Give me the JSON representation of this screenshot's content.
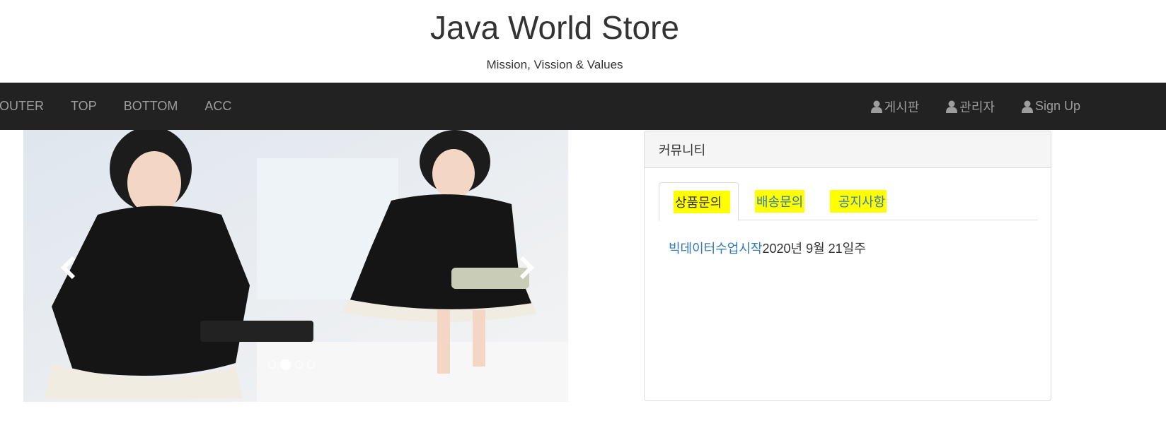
{
  "header": {
    "title": "Java World Store",
    "subtitle": "Mission, Vission & Values"
  },
  "navbar": {
    "left_items": [
      "OUTER",
      "TOP",
      "BOTTOM",
      "ACC"
    ],
    "right_items": [
      {
        "label": "게시판",
        "icon": "user-icon"
      },
      {
        "label": "관리자",
        "icon": "user-icon"
      },
      {
        "label": "Sign Up",
        "icon": "user-icon"
      }
    ]
  },
  "carousel": {
    "indicator_count": 4,
    "active_index": 1,
    "prev_icon": "chevron-left-icon",
    "next_icon": "chevron-right-icon"
  },
  "panel": {
    "heading": "커뮤니티",
    "tabs": [
      "상품문의",
      "배송문의",
      "공지사항"
    ],
    "active_tab": 0,
    "posts": [
      {
        "title": "빅데이터수업시작",
        "date": "2020년 9월 21일주"
      }
    ]
  },
  "colors": {
    "navbar_bg": "#222222",
    "nav_text": "#9d9d9d",
    "link": "#337ab7",
    "highlight": "#ffff00"
  }
}
